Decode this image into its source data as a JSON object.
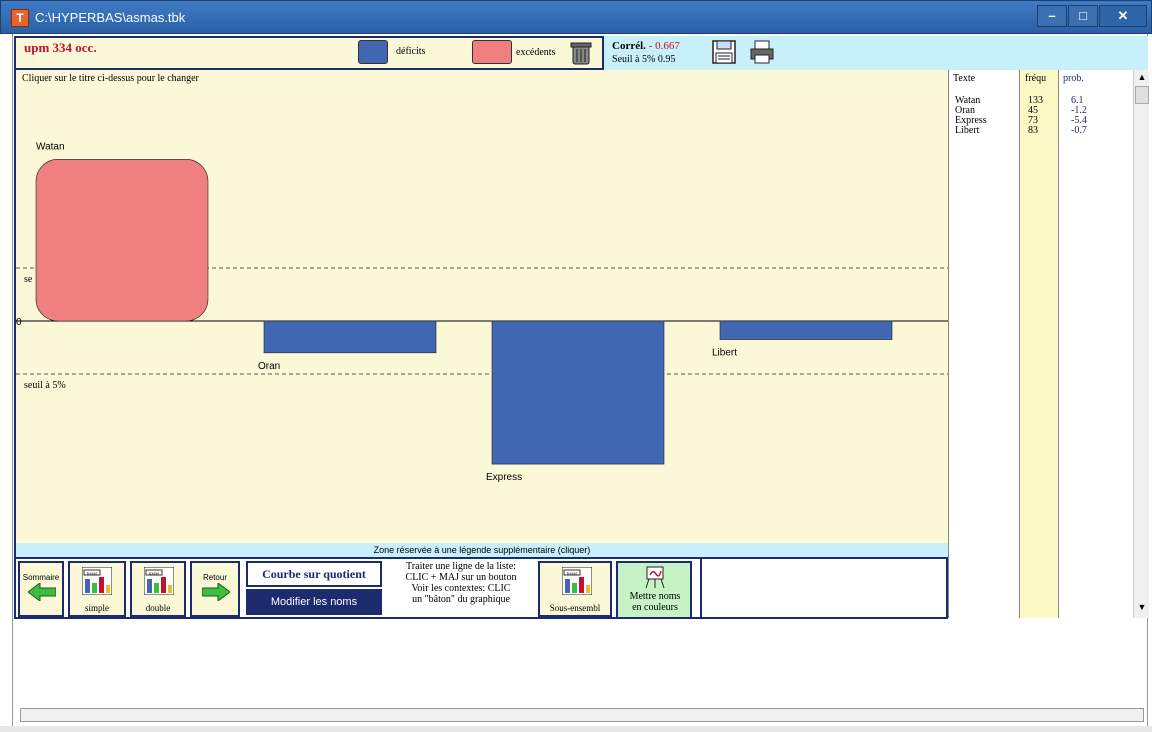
{
  "window": {
    "app_icon": "T",
    "title": "C:\\HYPERBAS\\asmas.tbk",
    "minimize": "–",
    "maximize": "□",
    "close": "✕"
  },
  "header": {
    "upm_label": "upm 334 occ.",
    "deficits_label": "déficits",
    "excedents_label": "excédents",
    "correl_label": "Corrél.",
    "correl_value": "- 0.667",
    "seuil_label": "Seuil à 5%",
    "seuil_value": "0.95"
  },
  "colors": {
    "deficit": "#4267b2",
    "excedent": "#f08080",
    "panel_bg": "#fbf8d8",
    "accent": "#1c2a6e"
  },
  "chart_hint": "Cliquer sur le titre ci-dessus pour le changer",
  "chart_data": {
    "type": "bar",
    "categories": [
      "Watan",
      "Oran",
      "Express",
      "Libert"
    ],
    "values": [
      6.1,
      -1.2,
      -5.4,
      -0.7
    ],
    "threshold_top_label": "se",
    "threshold_bottom_label": "seuil à 5%",
    "zero_label": "0",
    "ylim": [
      -6.3,
      6.3
    ],
    "threshold": 2
  },
  "table": {
    "headers": [
      "Texte",
      "fréqu",
      "prob."
    ],
    "rows": [
      {
        "texte": "Watan",
        "frequ": "133",
        "prob": "6.1"
      },
      {
        "texte": "Oran",
        "frequ": "45",
        "prob": "-1.2"
      },
      {
        "texte": "Express",
        "frequ": "73",
        "prob": "-5.4"
      },
      {
        "texte": "Libert",
        "frequ": "83",
        "prob": "-0.7"
      }
    ]
  },
  "legend_zone": "Zone réservée à une légende supplémentaire (cliquer)",
  "toolbar": {
    "sommaire": "Sommaire",
    "simple": "simple",
    "double": "double",
    "retour": "Retour",
    "courbe": "Courbe sur quotient",
    "modifier": "Modifier les noms",
    "traiter_1": "Traiter une ligne de la liste:",
    "traiter_2": "CLIC + MAJ sur un bouton",
    "traiter_3": "Voir les contextes: CLIC",
    "traiter_4": "un \"bâton\" du graphique",
    "sous_ensemble": "Sous-ensembl",
    "mettre_1": "Mettre noms",
    "mettre_2": "en couleurs",
    "excel_label": "Excel"
  },
  "scroll": {
    "up": "▲",
    "down": "▼"
  }
}
